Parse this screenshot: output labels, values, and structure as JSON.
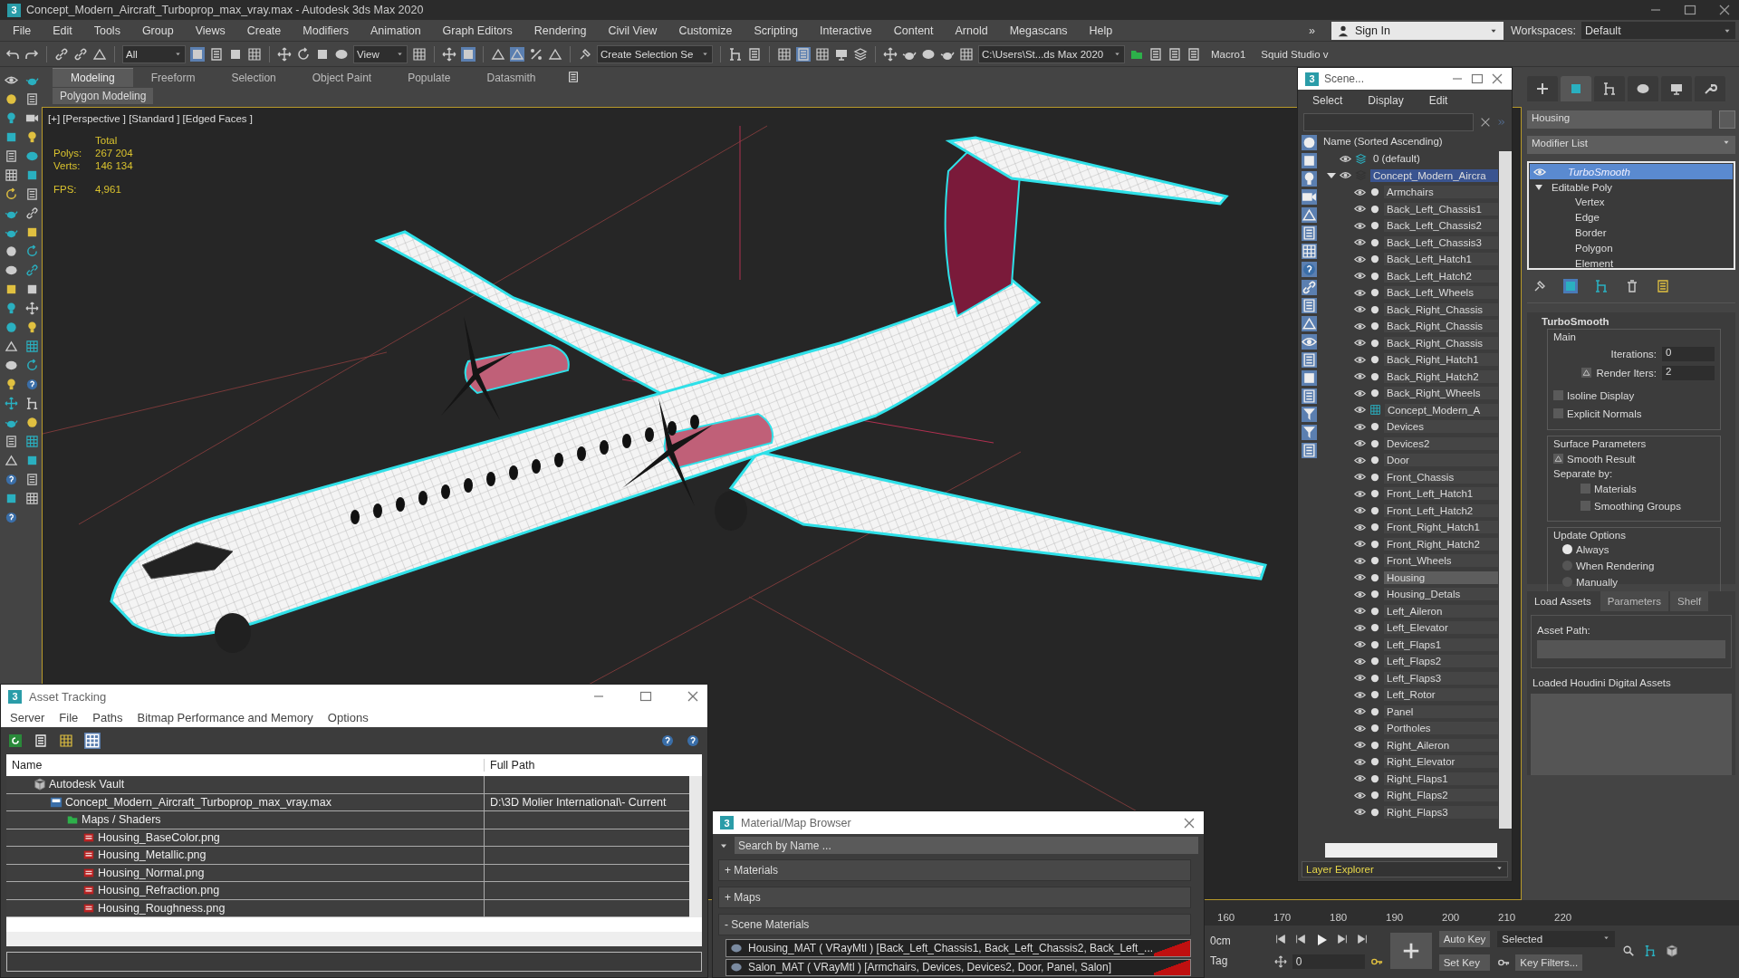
{
  "window": {
    "icon_label": "3",
    "title": "Concept_Modern_Aircraft_Turboprop_max_vray.max - Autodesk 3ds Max 2020"
  },
  "menu": {
    "items": [
      "File",
      "Edit",
      "Tools",
      "Group",
      "Views",
      "Create",
      "Modifiers",
      "Animation",
      "Graph Editors",
      "Rendering",
      "Civil View",
      "Customize",
      "Scripting",
      "Interactive",
      "Content",
      "Arnold",
      "Megascans",
      "Help"
    ],
    "overflow": "»",
    "sign_in": "Sign In",
    "workspaces_label": "Workspaces:",
    "workspace": "Default"
  },
  "toolbar": {
    "selection_filter": "All",
    "reference_coord": "View",
    "named_selection": "Create Selection Se",
    "project_path": "C:\\Users\\St...ds Max 2020",
    "macro": "Macro1",
    "plugin": "Squid Studio v"
  },
  "ribbon": {
    "tabs": [
      {
        "label": "Modeling",
        "selected": true
      },
      {
        "label": "Freeform",
        "selected": false
      },
      {
        "label": "Selection",
        "selected": false
      },
      {
        "label": "Object Paint",
        "selected": false
      },
      {
        "label": "Populate",
        "selected": false
      },
      {
        "label": "Datasmith",
        "selected": false
      }
    ],
    "panel": "Polygon Modeling"
  },
  "viewport": {
    "label": "[+] [Perspective ] [Standard ] [Edged Faces ]",
    "stats_header": "Total",
    "stats": [
      {
        "label": "Polys:",
        "value": "267 204"
      },
      {
        "label": "Verts:",
        "value": "146 134"
      }
    ],
    "fps_label": "FPS:",
    "fps": "4,961"
  },
  "scene_explorer": {
    "icon_label": "3",
    "title": "Scene...",
    "menu": [
      "Select",
      "Display",
      "Edit"
    ],
    "column": "Name (Sorted Ascending)",
    "layers": [
      {
        "name": "0 (default)",
        "selected": false
      },
      {
        "name": "Concept_Modern_Aircra",
        "selected": true,
        "expanded": true,
        "children": [
          {
            "name": "Armchairs",
            "kind": "object",
            "selected": false
          },
          {
            "name": "Back_Left_Chassis1",
            "kind": "object",
            "selected": false
          },
          {
            "name": "Back_Left_Chassis2",
            "kind": "object",
            "selected": false
          },
          {
            "name": "Back_Left_Chassis3",
            "kind": "object",
            "selected": false
          },
          {
            "name": "Back_Left_Hatch1",
            "kind": "object",
            "selected": false
          },
          {
            "name": "Back_Left_Hatch2",
            "kind": "object",
            "selected": false
          },
          {
            "name": "Back_Left_Wheels",
            "kind": "object",
            "selected": false
          },
          {
            "name": "Back_Right_Chassis",
            "kind": "object",
            "selected": false
          },
          {
            "name": "Back_Right_Chassis",
            "kind": "object",
            "selected": false
          },
          {
            "name": "Back_Right_Chassis",
            "kind": "object",
            "selected": false
          },
          {
            "name": "Back_Right_Hatch1",
            "kind": "object",
            "selected": false
          },
          {
            "name": "Back_Right_Hatch2",
            "kind": "object",
            "selected": false
          },
          {
            "name": "Back_Right_Wheels",
            "kind": "object",
            "selected": false
          },
          {
            "name": "Concept_Modern_A",
            "kind": "group",
            "selected": false
          },
          {
            "name": "Devices",
            "kind": "object",
            "selected": false
          },
          {
            "name": "Devices2",
            "kind": "object",
            "selected": false
          },
          {
            "name": "Door",
            "kind": "object",
            "selected": false
          },
          {
            "name": "Front_Chassis",
            "kind": "object",
            "selected": false
          },
          {
            "name": "Front_Left_Hatch1",
            "kind": "object",
            "selected": false
          },
          {
            "name": "Front_Left_Hatch2",
            "kind": "object",
            "selected": false
          },
          {
            "name": "Front_Right_Hatch1",
            "kind": "object",
            "selected": false
          },
          {
            "name": "Front_Right_Hatch2",
            "kind": "object",
            "selected": false
          },
          {
            "name": "Front_Wheels",
            "kind": "object",
            "selected": false
          },
          {
            "name": "Housing",
            "kind": "object",
            "selected": true
          },
          {
            "name": "Housing_Detals",
            "kind": "object",
            "selected": false
          },
          {
            "name": "Left_Aileron",
            "kind": "object",
            "selected": false
          },
          {
            "name": "Left_Elevator",
            "kind": "object",
            "selected": false
          },
          {
            "name": "Left_Flaps1",
            "kind": "object",
            "selected": false
          },
          {
            "name": "Left_Flaps2",
            "kind": "object",
            "selected": false
          },
          {
            "name": "Left_Flaps3",
            "kind": "object",
            "selected": false
          },
          {
            "name": "Left_Rotor",
            "kind": "object",
            "selected": false
          },
          {
            "name": "Panel",
            "kind": "object",
            "selected": false
          },
          {
            "name": "Portholes",
            "kind": "object",
            "selected": false
          },
          {
            "name": "Right_Aileron",
            "kind": "object",
            "selected": false
          },
          {
            "name": "Right_Elevator",
            "kind": "object",
            "selected": false
          },
          {
            "name": "Right_Flaps1",
            "kind": "object",
            "selected": false
          },
          {
            "name": "Right_Flaps2",
            "kind": "object",
            "selected": false
          },
          {
            "name": "Right_Flaps3",
            "kind": "object",
            "selected": false
          }
        ]
      }
    ],
    "footer": "Layer Explorer"
  },
  "command_panel": {
    "tabs": [
      {
        "kind": "create",
        "selected": false
      },
      {
        "kind": "modify",
        "selected": true
      },
      {
        "kind": "hierarchy",
        "selected": false
      },
      {
        "kind": "motion",
        "selected": false
      },
      {
        "kind": "display",
        "selected": false
      },
      {
        "kind": "utilities",
        "selected": false
      }
    ],
    "object_name": "Housing",
    "modifier_list": "Modifier List",
    "stack": {
      "top": "TurboSmooth",
      "base": "Editable Poly",
      "expanded": true,
      "subobjects": [
        "Vertex",
        "Edge",
        "Border",
        "Polygon",
        "Element"
      ]
    },
    "rollout": {
      "title": "TurboSmooth",
      "main": "Main",
      "iterations_label": "Iterations:",
      "iterations": "0",
      "render_iters": {
        "label": "Render Iters:",
        "checked": true,
        "value": "2"
      },
      "options": [
        {
          "label": "Isoline Display",
          "checked": false
        },
        {
          "label": "Explicit Normals",
          "checked": false
        }
      ],
      "surface": "Surface Parameters",
      "smooth_result": {
        "label": "Smooth Result",
        "checked": true
      },
      "separate_by": "Separate by:",
      "separate": [
        {
          "label": "Materials",
          "checked": false
        },
        {
          "label": "Smoothing Groups",
          "checked": false
        }
      ],
      "update": "Update Options",
      "update_modes": [
        {
          "label": "Always",
          "selected": true
        },
        {
          "label": "When Rendering",
          "selected": false
        },
        {
          "label": "Manually",
          "selected": false
        }
      ]
    }
  },
  "houdini": {
    "tabs": [
      {
        "label": "Load Assets",
        "selected": true
      },
      {
        "label": "Parameters",
        "selected": false
      },
      {
        "label": "Shelf",
        "selected": false
      }
    ],
    "asset_path": "Asset Path:",
    "loaded": "Loaded Houdini Digital Assets"
  },
  "asset_tracking": {
    "icon_label": "3",
    "title": "Asset Tracking",
    "menu": [
      "Server",
      "File",
      "Paths",
      "Bitmap Performance and Memory",
      "Options"
    ],
    "columns": [
      "Name",
      "Full Path"
    ],
    "rows": [
      {
        "name": "Autodesk Vault",
        "kind": "vault",
        "children": [
          {
            "name": "Concept_Modern_Aircraft_Turboprop_max_vray.max",
            "kind": "max",
            "path": "D:\\3D Molier International\\- Current",
            "children": [
              {
                "name": "Maps / Shaders",
                "kind": "folder",
                "children": [
                  {
                    "name": "Housing_BaseColor.png",
                    "kind": "png"
                  },
                  {
                    "name": "Housing_Metallic.png",
                    "kind": "png"
                  },
                  {
                    "name": "Housing_Normal.png",
                    "kind": "png"
                  },
                  {
                    "name": "Housing_Refraction.png",
                    "kind": "png"
                  },
                  {
                    "name": "Housing_Roughness.png",
                    "kind": "png"
                  }
                ]
              }
            ]
          }
        ]
      }
    ]
  },
  "material_browser": {
    "icon_label": "3",
    "title": "Material/Map Browser",
    "search_placeholder": "Search by Name ...",
    "groups": [
      {
        "sign": "+",
        "label": "Materials"
      },
      {
        "sign": "+",
        "label": "Maps"
      },
      {
        "sign": "-",
        "label": "Scene Materials"
      }
    ],
    "materials": [
      "Housing_MAT ( VRayMtl ) [Back_Left_Chassis1, Back_Left_Chassis2, Back_Left_...",
      "Salon_MAT ( VRayMtl ) [Armchairs, Devices, Devices2, Door, Panel, Salon]"
    ]
  },
  "timeline": {
    "ticks": [
      "160",
      "170",
      "180",
      "190",
      "200",
      "210",
      "220"
    ],
    "grid_status": "0cm",
    "tag": "Tag",
    "auto_key": "Auto Key",
    "key_mode": "Selected",
    "set_key": "Set Key",
    "frame": "0",
    "key_filters": "Key Filters..."
  }
}
